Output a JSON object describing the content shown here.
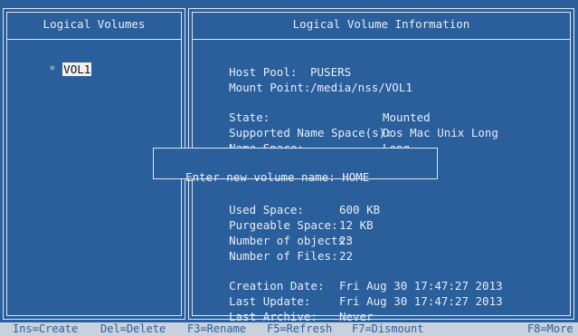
{
  "left_panel": {
    "title": "Logical Volumes",
    "marker": "*",
    "volume_name": "VOL1"
  },
  "right_panel": {
    "title": "Logical Volume Information",
    "fields": {
      "host_pool_label": "Host Pool:",
      "host_pool_value": "PUSERS",
      "mount_point_label": "Mount Point:",
      "mount_point_value": "/media/nss/VOL1",
      "state_label": "State:",
      "state_value": "Mounted",
      "supported_ns_label": "Supported Name Space(s):",
      "supported_ns_value": "Dos Mac Unix Long",
      "name_space_label": "Name Space:",
      "name_space_value": "Long",
      "used_space_label": "Used Space:",
      "used_space_value": "600 KB",
      "purgeable_label": "Purgeable Space:",
      "purgeable_value": "12 KB",
      "num_objects_label": "Number of objects:",
      "num_objects_value": "23",
      "num_files_label": "Number of Files:",
      "num_files_value": "22",
      "creation_label": "Creation Date:",
      "creation_value": "Fri Aug 30 17:47:27 2013",
      "last_update_label": "Last Update:",
      "last_update_value": "Fri Aug 30 17:47:27 2013",
      "last_archive_label": "Last Archive:",
      "last_archive_value": "Never"
    }
  },
  "dialog": {
    "prompt": "Enter new volume name:",
    "value": "HOME"
  },
  "function_keys": {
    "ins": "Ins=Create",
    "del": "Del=Delete",
    "f3": "F3=Rename",
    "f5": "F5=Refresh",
    "f7": "F7=Dismount",
    "f8": "F8=More"
  },
  "colors": {
    "background": "#2a5f9c",
    "text": "#e6eef8",
    "frame": "#dbe6f3",
    "fkey_bar": "#c8d1dc"
  }
}
